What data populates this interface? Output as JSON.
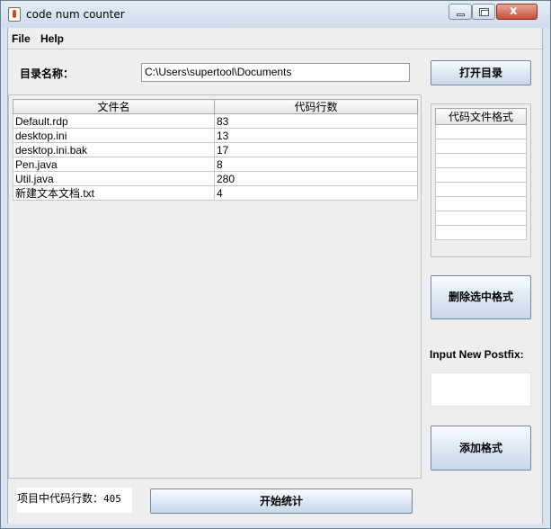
{
  "window": {
    "title": "code num counter",
    "minimize_label": "",
    "maximize_label": "",
    "close_label": "x"
  },
  "menu": {
    "file": "File",
    "help": "Help"
  },
  "directory": {
    "label": "目录名称：",
    "path": "C:\\Users\\supertool\\Documents",
    "open_button": "打开目录"
  },
  "file_table": {
    "headers": [
      "文件名",
      "代码行数"
    ],
    "rows": [
      [
        "Default.rdp",
        "83"
      ],
      [
        "desktop.ini",
        "13"
      ],
      [
        "desktop.ini.bak",
        "17"
      ],
      [
        "Pen.java",
        "8"
      ],
      [
        "Util.java",
        "280"
      ],
      [
        "新建文本文档.txt",
        "4"
      ]
    ]
  },
  "formats": {
    "header": "代码文件格式",
    "items": [
      "",
      "",
      "",
      "",
      "",
      "",
      "",
      ""
    ],
    "delete_button": "删除选中格式",
    "postfix_label": "Input New Postfix:",
    "postfix_value": "",
    "add_button": "添加格式"
  },
  "summary": {
    "label": "项目中代码行数：",
    "count": "405",
    "start_button": "开始统计"
  }
}
